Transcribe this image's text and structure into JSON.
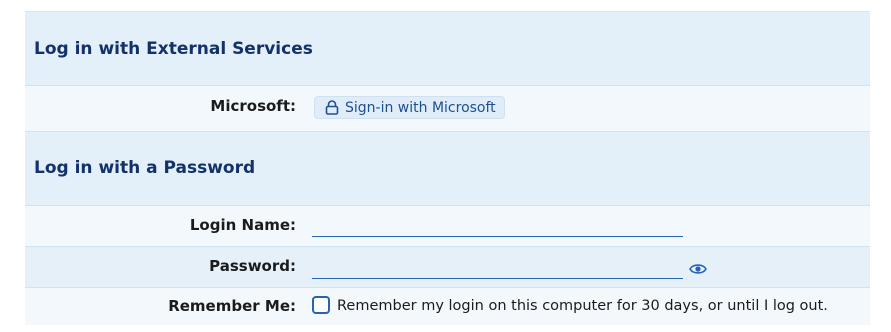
{
  "external_section": {
    "title": "Log in with External Services",
    "microsoft_label": "Microsoft:",
    "microsoft_button": "Sign-in with Microsoft"
  },
  "password_section": {
    "title": "Log in with a Password",
    "login_name_label": "Login Name:",
    "login_name_value": "",
    "password_label": "Password:",
    "password_value": "",
    "remember_label": "Remember Me:",
    "remember_text": "Remember my login on this computer for 30 days, or until I log out.",
    "remember_checked": false
  },
  "colors": {
    "heading": "#13326a",
    "accent": "#2463b5",
    "section_bg": "#e3eff9"
  },
  "icons": {
    "lock": "lock-icon",
    "eye": "eye-icon"
  }
}
